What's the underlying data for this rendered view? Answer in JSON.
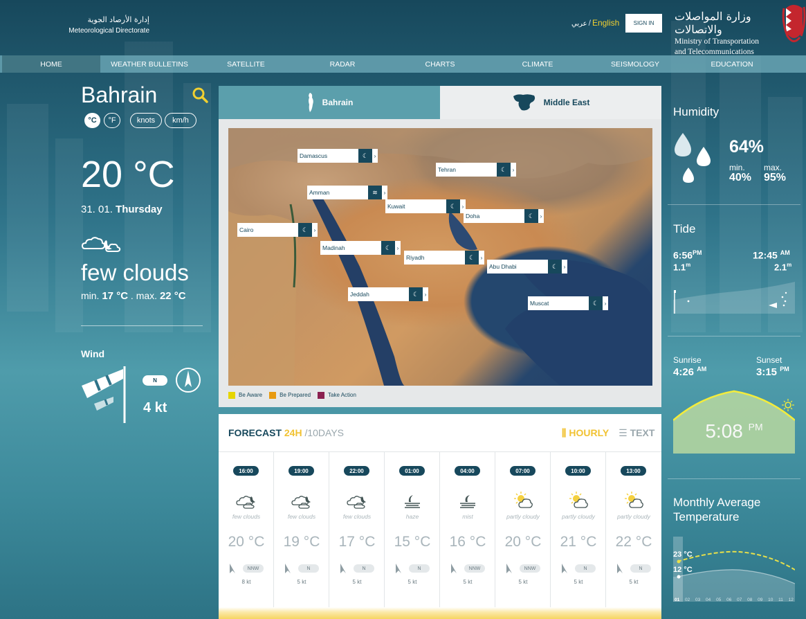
{
  "header": {
    "logo_ar": "إدارة الأرصاد الجوية",
    "logo_en": "Meteorological Directorate",
    "lang_ar": "عربي",
    "lang_sep": "/",
    "lang_en": "English",
    "signin_label": "SIGN IN",
    "ministry_ar": "وزارة المواصلات والاتصالات",
    "ministry_en_line1": "Ministry of Transportation",
    "ministry_en_line2": "and Telecommunications"
  },
  "nav": {
    "items": [
      "HOME",
      "WEATHER BULLETINS",
      "SATELLITE",
      "RADAR",
      "CHARTS",
      "CLIMATE",
      "SEISMOLOGY",
      "EDUCATION"
    ],
    "active": "HOME"
  },
  "current": {
    "location": "Bahrain",
    "units": {
      "celsius": "°C",
      "fahrenheit": "°F",
      "knots": "knots",
      "kmh": "km/h"
    },
    "temperature": "20 °C",
    "date_prefix": "31. 01.",
    "weekday": "Thursday",
    "condition": "few clouds",
    "min_label": "min.",
    "min_value": "17 °C",
    "max_label": "max.",
    "max_value": "22 °C",
    "wind_label": "Wind",
    "wind_direction": "N",
    "wind_speed": "4 kt"
  },
  "tabs": {
    "bahrain": "Bahrain",
    "middle_east": "Middle East",
    "active": "Bahrain"
  },
  "map": {
    "cities": [
      {
        "name": "Damascus",
        "icon": "moon-icon"
      },
      {
        "name": "Tehran",
        "icon": "moon-icon"
      },
      {
        "name": "Amman",
        "icon": "mist-icon"
      },
      {
        "name": "Kuwait",
        "icon": "moon-icon"
      },
      {
        "name": "Doha",
        "icon": "moon-icon"
      },
      {
        "name": "Cairo",
        "icon": "moon-icon"
      },
      {
        "name": "Madinah",
        "icon": "moon-icon"
      },
      {
        "name": "Riyadh",
        "icon": "moon-icon"
      },
      {
        "name": "Abu Dhabi",
        "icon": "moon-icon"
      },
      {
        "name": "Jeddah",
        "icon": "moon-icon"
      },
      {
        "name": "Muscat",
        "icon": "moon-icon"
      }
    ],
    "legend": [
      {
        "label": "Be Aware",
        "color": "#e6d500"
      },
      {
        "label": "Be Prepared",
        "color": "#e89a10"
      },
      {
        "label": "Take Action",
        "color": "#8b2150"
      }
    ]
  },
  "forecast": {
    "title": "FORECAST",
    "range_24h": "24H",
    "range_sep": "/",
    "range_10days": "10DAYS",
    "mode_hourly": "HOURLY",
    "mode_text": "TEXT",
    "hours": [
      {
        "time": "16:00",
        "icon": "cloud-moon-icon",
        "desc": "few clouds",
        "temp": "20 °C",
        "dir": "NNW",
        "speed": "8 kt"
      },
      {
        "time": "19:00",
        "icon": "cloud-moon-icon",
        "desc": "few clouds",
        "temp": "19 °C",
        "dir": "N",
        "speed": "5 kt"
      },
      {
        "time": "22:00",
        "icon": "cloud-moon-icon",
        "desc": "few clouds",
        "temp": "17 °C",
        "dir": "N",
        "speed": "5 kt"
      },
      {
        "time": "01:00",
        "icon": "haze-icon",
        "desc": "haze",
        "temp": "15 °C",
        "dir": "N",
        "speed": "5 kt"
      },
      {
        "time": "04:00",
        "icon": "mist-icon",
        "desc": "mist",
        "temp": "16 °C",
        "dir": "NNW",
        "speed": "5 kt"
      },
      {
        "time": "07:00",
        "icon": "sun-cloud-icon",
        "desc": "partly cloudy",
        "temp": "20 °C",
        "dir": "NNW",
        "speed": "5 kt"
      },
      {
        "time": "10:00",
        "icon": "sun-cloud-icon",
        "desc": "partly cloudy",
        "temp": "21 °C",
        "dir": "N",
        "speed": "5 kt"
      },
      {
        "time": "13:00",
        "icon": "sun-cloud-icon",
        "desc": "partly cloudy",
        "temp": "22 °C",
        "dir": "N",
        "speed": "5 kt"
      }
    ]
  },
  "humidity": {
    "title": "Humidity",
    "value": "64%",
    "min_label": "min.",
    "min_value": "40%",
    "max_label": "max.",
    "max_value": "95%"
  },
  "tide": {
    "title": "Tide",
    "low_time": "6:56",
    "low_period": "PM",
    "low_height": "1.1",
    "low_unit": "m",
    "high_time": "12:45",
    "high_period": "AM",
    "high_height": "2.1",
    "high_unit": "m"
  },
  "sun": {
    "sunrise_label": "Sunrise",
    "sunrise_time": "4:26",
    "sunrise_period": "AM",
    "sunset_label": "Sunset",
    "sunset_time": "3:15",
    "sunset_period": "PM",
    "now_time": "5:08",
    "now_period": "PM"
  },
  "monthly": {
    "title": "Monthly Average Temperature",
    "high": "23 °C",
    "low": "12 °C",
    "months": [
      "01",
      "02",
      "03",
      "04",
      "05",
      "06",
      "07",
      "08",
      "09",
      "10",
      "11",
      "12"
    ],
    "active_month": "01"
  }
}
